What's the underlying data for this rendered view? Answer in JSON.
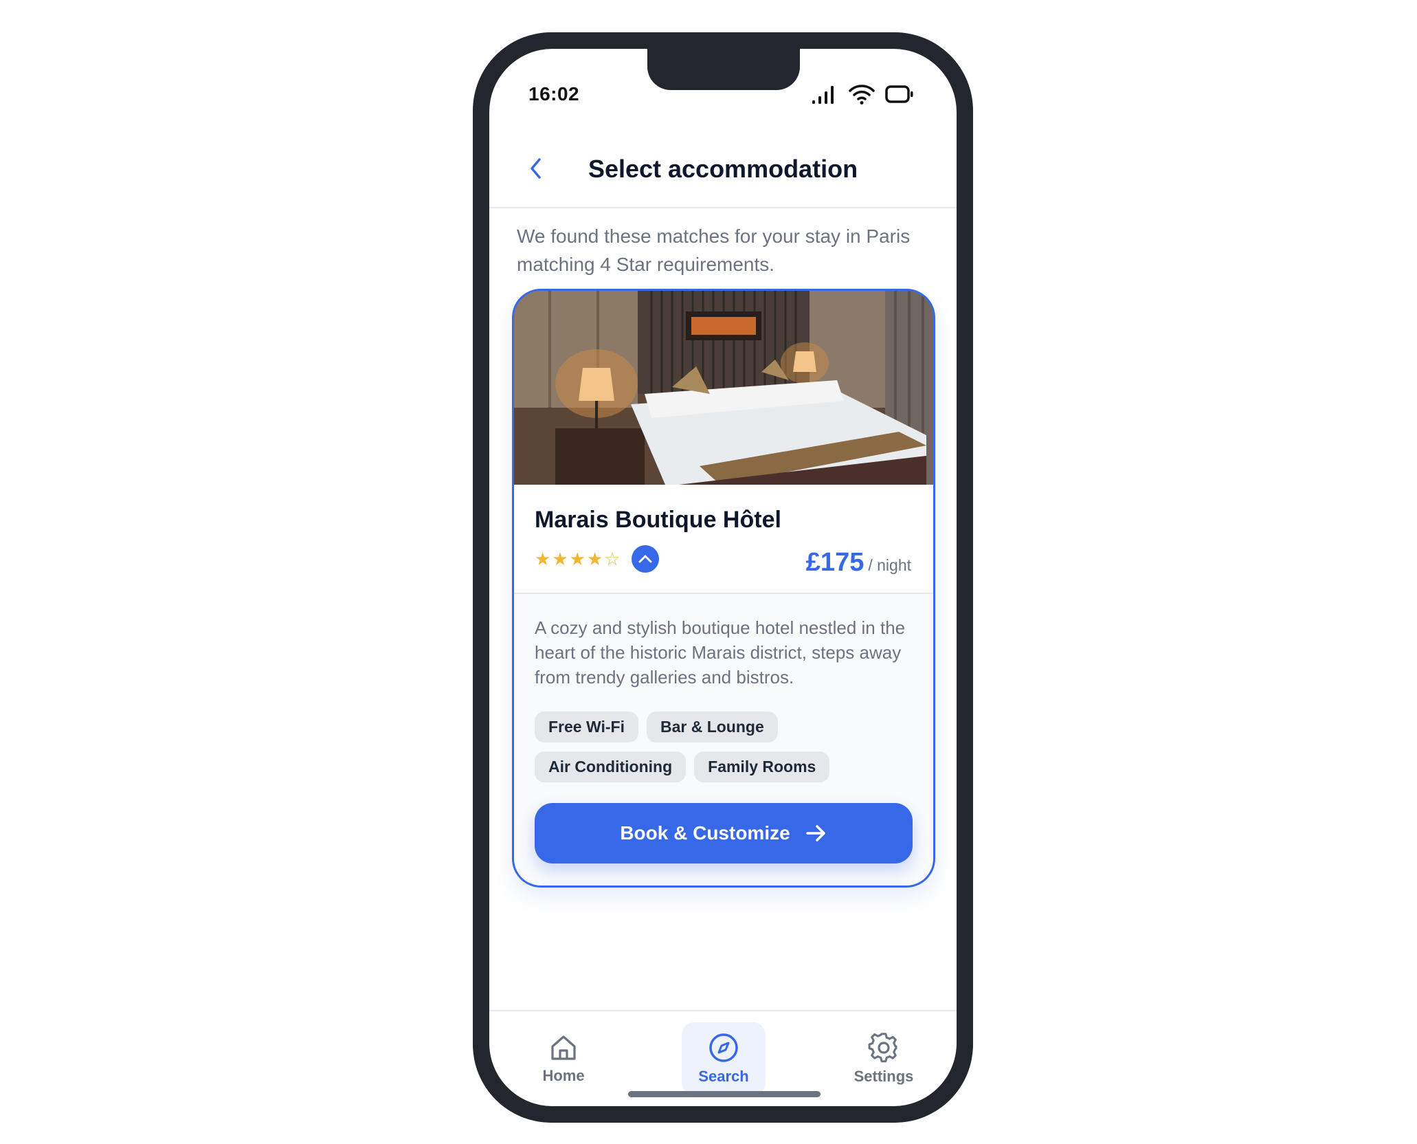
{
  "status_bar": {
    "time": "16:02"
  },
  "header": {
    "title": "Select accommodation"
  },
  "intro_text": "We found these matches for your stay in Paris matching 4 Star requirements.",
  "hotel": {
    "name": "Marais Boutique Hôtel",
    "rating": 4,
    "rating_max": 5,
    "price": "£175",
    "price_unit": "/ night",
    "description": "A cozy and stylish boutique hotel nestled in the heart of the historic Marais district, steps away from trendy galleries and bistros.",
    "amenities": [
      "Free Wi-Fi",
      "Bar & Lounge",
      "Air Conditioning",
      "Family Rooms"
    ],
    "book_label": "Book & Customize"
  },
  "nav": {
    "home": "Home",
    "search": "Search",
    "settings": "Settings",
    "active": "search"
  },
  "colors": {
    "accent": "#3768e8",
    "star": "#f2b632",
    "frame": "#23262d"
  }
}
